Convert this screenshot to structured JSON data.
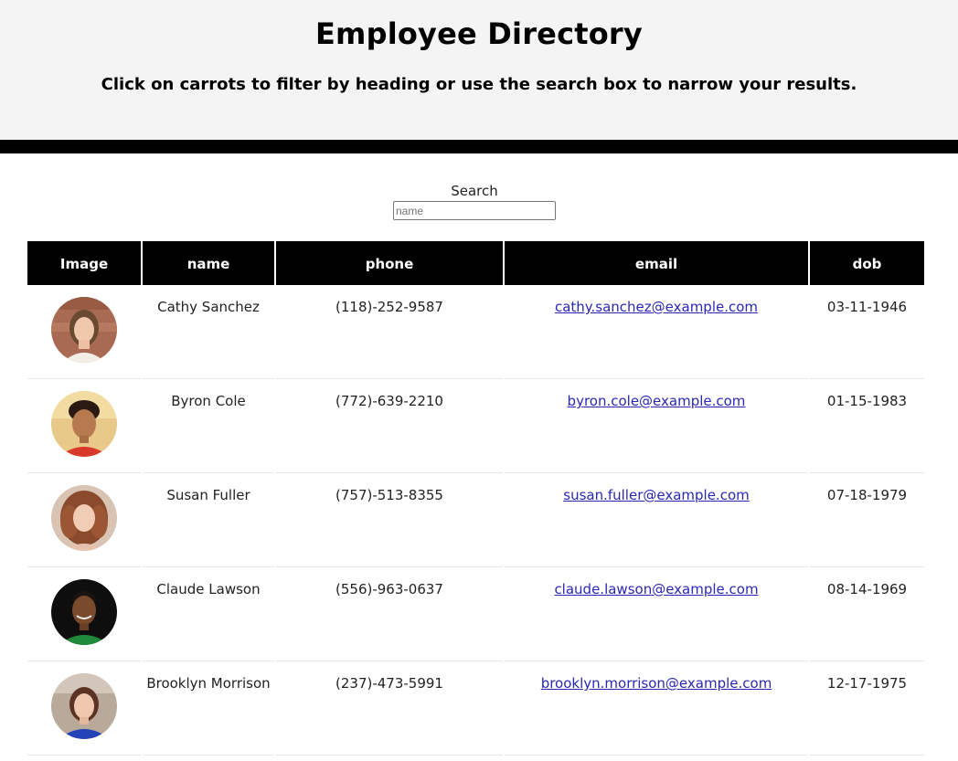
{
  "header": {
    "title": "Employee Directory",
    "subtitle": "Click on carrots to filter by heading or use the search box to narrow your results."
  },
  "search": {
    "label": "Search",
    "placeholder": "name",
    "value": ""
  },
  "table": {
    "columns": [
      "Image",
      "name",
      "phone",
      "email",
      "dob"
    ],
    "rows": [
      {
        "name": "Cathy Sanchez",
        "phone": "(118)-252-9587",
        "email": "cathy.sanchez@example.com",
        "dob": "03-11-1946"
      },
      {
        "name": "Byron Cole",
        "phone": "(772)-639-2210",
        "email": "byron.cole@example.com",
        "dob": "01-15-1983"
      },
      {
        "name": "Susan Fuller",
        "phone": "(757)-513-8355",
        "email": "susan.fuller@example.com",
        "dob": "07-18-1979"
      },
      {
        "name": "Claude Lawson",
        "phone": "(556)-963-0637",
        "email": "claude.lawson@example.com",
        "dob": "08-14-1969"
      },
      {
        "name": "Brooklyn Morrison",
        "phone": "(237)-473-5991",
        "email": "brooklyn.morrison@example.com",
        "dob": "12-17-1975"
      }
    ]
  },
  "colors": {
    "header_bg": "#f4f4f4",
    "bar": "#000000",
    "link": "#2a27b6"
  }
}
